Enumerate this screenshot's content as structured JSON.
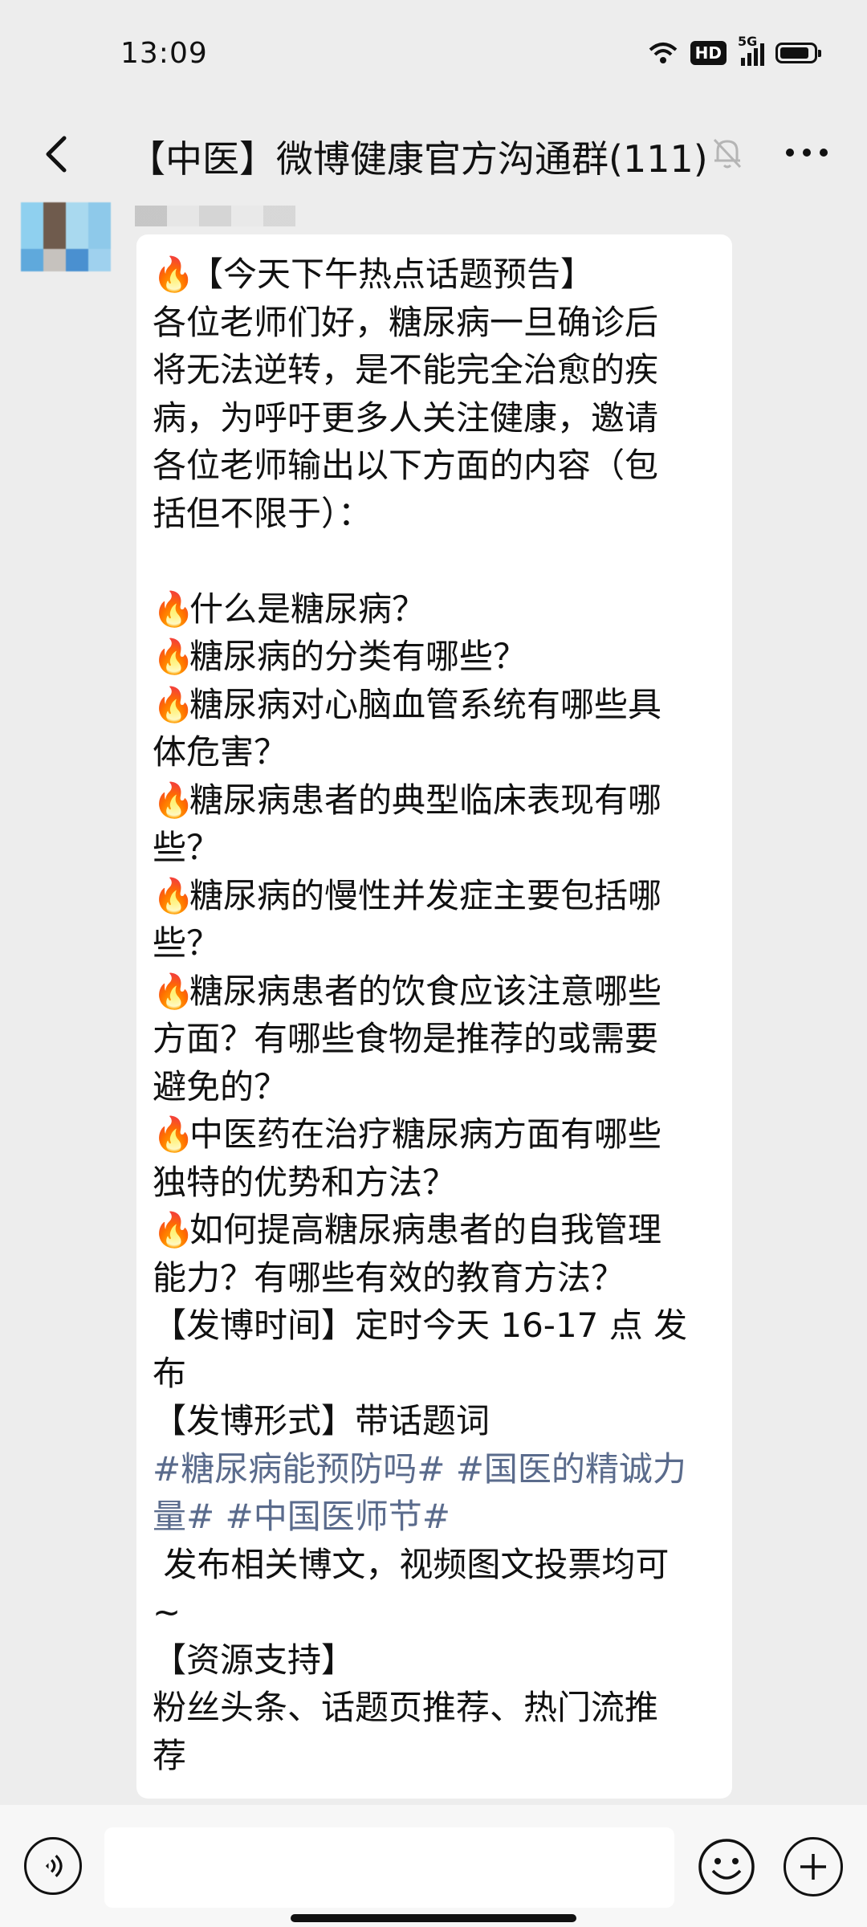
{
  "status_bar": {
    "time": "13:09",
    "hd_label": "HD",
    "net_label": "5G",
    "battery_level": 0.9
  },
  "header": {
    "title": "【中医】微博健康官方沟通群(111)"
  },
  "message": {
    "lines": [
      {
        "fire": true,
        "text": "【今天下午热点话题预告】"
      },
      {
        "fire": false,
        "text": "各位老师们好，糖尿病一旦确诊后"
      },
      {
        "fire": false,
        "text": "将无法逆转，是不能完全治愈的疾"
      },
      {
        "fire": false,
        "text": "病，为呼吁更多人关注健康，邀请"
      },
      {
        "fire": false,
        "text": "各位老师输出以下方面的内容（包"
      },
      {
        "fire": false,
        "text": "括但不限于）："
      },
      {
        "fire": false,
        "text": ""
      },
      {
        "fire": true,
        "text": "什么是糖尿病？"
      },
      {
        "fire": true,
        "text": "糖尿病的分类有哪些？"
      },
      {
        "fire": true,
        "text": "糖尿病对心脑血管系统有哪些具"
      },
      {
        "fire": false,
        "text": "体危害？"
      },
      {
        "fire": true,
        "text": "糖尿病患者的典型临床表现有哪"
      },
      {
        "fire": false,
        "text": "些？"
      },
      {
        "fire": true,
        "text": "糖尿病的慢性并发症主要包括哪"
      },
      {
        "fire": false,
        "text": "些？"
      },
      {
        "fire": true,
        "text": "糖尿病患者的饮食应该注意哪些"
      },
      {
        "fire": false,
        "text": "方面？有哪些食物是推荐的或需要"
      },
      {
        "fire": false,
        "text": "避免的？"
      },
      {
        "fire": true,
        "text": "中医药在治疗糖尿病方面有哪些"
      },
      {
        "fire": false,
        "text": "独特的优势和方法？"
      },
      {
        "fire": true,
        "text": "如何提高糖尿病患者的自我管理"
      },
      {
        "fire": false,
        "text": "能力？有哪些有效的教育方法？"
      },
      {
        "fire": false,
        "text": "【发博时间】定时今天 16-17 点 发"
      },
      {
        "fire": false,
        "text": "布"
      },
      {
        "fire": false,
        "text": "【发博形式】带话题词"
      }
    ],
    "hashtag_line1": "#糖尿病能预防吗# #国医的精诚力",
    "hashtag_line2": "量# #中国医师节#",
    "tail_lines": [
      " 发布相关博文，视频图文投票均可",
      "~",
      "【资源支持】",
      "粉丝头条、话题页推荐、热门流推",
      "荐"
    ]
  },
  "icons": {
    "back": "chevron-left-icon",
    "bell": "muted-bell-icon",
    "more": "more-dots-icon",
    "fire": "fire-emoji",
    "voice": "voice-icon",
    "emoji": "emoji-icon",
    "plus": "plus-icon"
  }
}
